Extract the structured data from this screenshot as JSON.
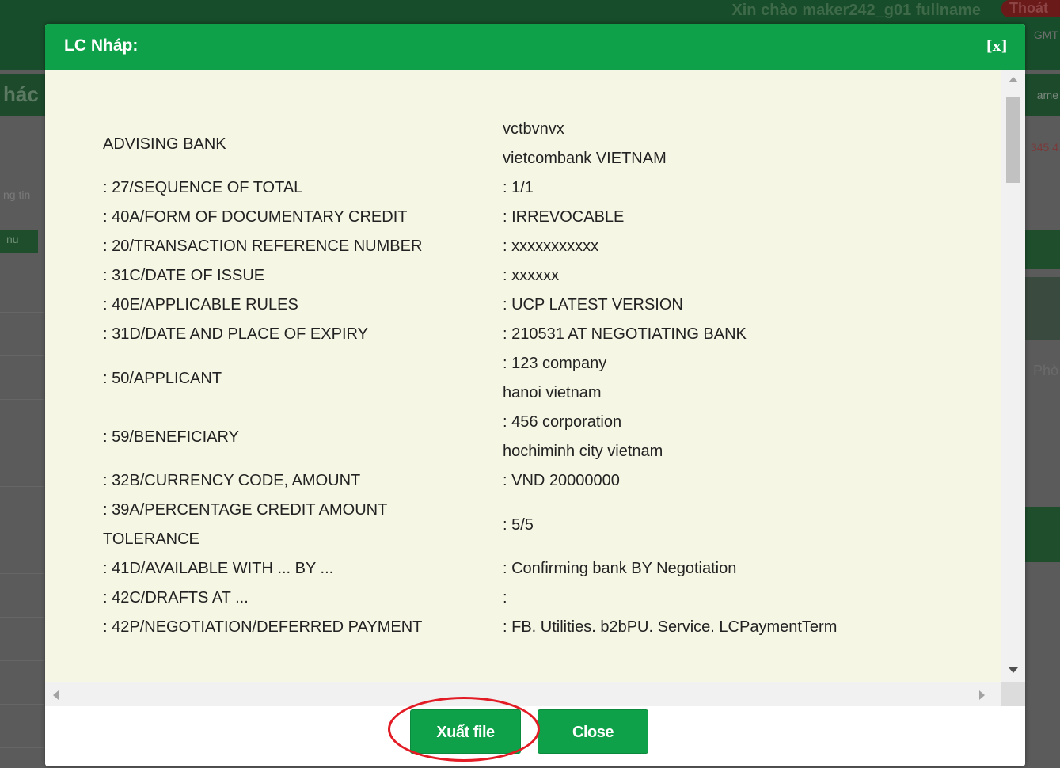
{
  "background": {
    "greeting": "Xin chào maker242_g01 fullname",
    "logout": "Thoát",
    "gmt": "GMT",
    "left_label": "hác",
    "right_label": "ame",
    "red_text": "345 4",
    "gray_text": "ng tin",
    "menu_label": "nu",
    "right_text": "Phò"
  },
  "modal": {
    "title": "LC Nháp:",
    "close_label": "[x]",
    "rows": [
      {
        "label": [
          "ADVISING BANK"
        ],
        "value": [
          "vctbvnvx",
          "vietcombank VIETNAM"
        ]
      },
      {
        "label": [
          ": 27/SEQUENCE OF TOTAL"
        ],
        "value": [
          ": 1/1"
        ]
      },
      {
        "label": [
          ": 40A/FORM OF DOCUMENTARY CREDIT"
        ],
        "value": [
          ": IRREVOCABLE"
        ]
      },
      {
        "label": [
          ": 20/TRANSACTION REFERENCE NUMBER"
        ],
        "value": [
          ": xxxxxxxxxxx"
        ]
      },
      {
        "label": [
          ": 31C/DATE OF ISSUE"
        ],
        "value": [
          ": xxxxxx"
        ]
      },
      {
        "label": [
          ": 40E/APPLICABLE RULES"
        ],
        "value": [
          ": UCP LATEST VERSION"
        ]
      },
      {
        "label": [
          ": 31D/DATE AND PLACE OF EXPIRY"
        ],
        "value": [
          ": 210531 AT NEGOTIATING BANK"
        ]
      },
      {
        "label": [
          ": 50/APPLICANT"
        ],
        "value": [
          ": 123 company",
          "hanoi vietnam"
        ]
      },
      {
        "label": [
          ": 59/BENEFICIARY"
        ],
        "value": [
          ": 456 corporation",
          "hochiminh city vietnam"
        ]
      },
      {
        "label": [
          ": 32B/CURRENCY CODE, AMOUNT"
        ],
        "value": [
          ": VND 20000000"
        ]
      },
      {
        "label": [
          ": 39A/PERCENTAGE CREDIT AMOUNT",
          "TOLERANCE"
        ],
        "value": [
          ": 5/5"
        ]
      },
      {
        "label": [
          ": 41D/AVAILABLE WITH ... BY ..."
        ],
        "value": [
          ": Confirming bank BY Negotiation"
        ]
      },
      {
        "label": [
          ": 42C/DRAFTS AT ..."
        ],
        "value": [
          ":"
        ]
      },
      {
        "label": [
          ": 42P/NEGOTIATION/DEFERRED PAYMENT"
        ],
        "value": [
          ": FB. Utilities. b2bPU. Service. LCPaymentTerm"
        ]
      }
    ],
    "buttons": {
      "export": "Xuất file",
      "close": "Close"
    },
    "colors": {
      "header": "#0fa14a",
      "body": "#f6f6e4",
      "highlight": "#e21b24"
    }
  }
}
